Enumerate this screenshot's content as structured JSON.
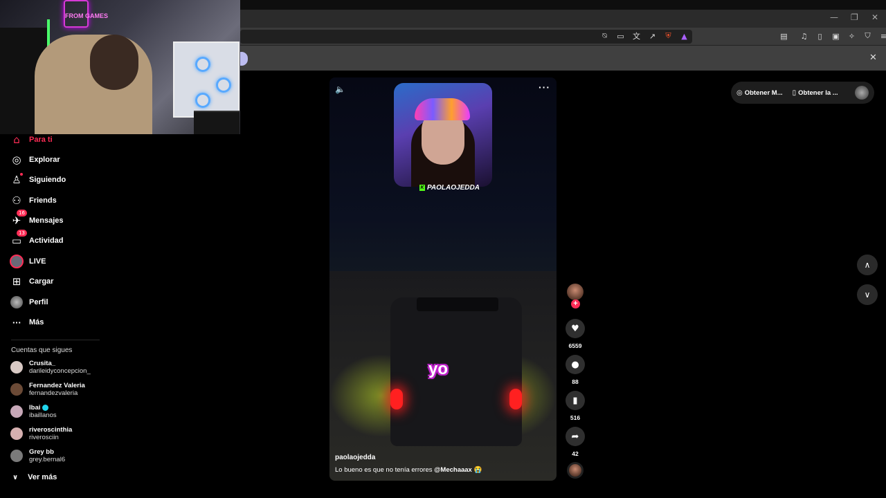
{
  "browser": {
    "window_controls": [
      "—",
      "❐",
      "✕"
    ],
    "toolbar_icons": [
      "no-wifi-icon",
      "cast-icon",
      "translate-icon",
      "share-icon",
      "brave-shield-icon",
      "brave-rewards-icon"
    ],
    "right_icons": [
      "reader-icon",
      "music-icon",
      "sidebar-icon",
      "wallet-icon",
      "leo-icon",
      "vpn-icon",
      "menu-icon"
    ],
    "bookmark_close": "✕"
  },
  "webcam": {
    "neon_sign": "FROM GAMES"
  },
  "sidebar": {
    "items": [
      {
        "label": "Para ti",
        "icon": "home-icon",
        "glyph": "⌂",
        "active": true
      },
      {
        "label": "Explorar",
        "icon": "compass-icon",
        "glyph": "◎"
      },
      {
        "label": "Siguiendo",
        "icon": "following-icon",
        "glyph": "♙"
      },
      {
        "label": "Friends",
        "icon": "friends-icon",
        "glyph": "⚇"
      },
      {
        "label": "Mensajes",
        "icon": "messages-icon",
        "glyph": "✈",
        "badge": "16"
      },
      {
        "label": "Actividad",
        "icon": "activity-icon",
        "glyph": "▭",
        "badge": "13"
      },
      {
        "label": "LIVE",
        "icon": "live-icon"
      },
      {
        "label": "Cargar",
        "icon": "upload-icon",
        "glyph": "⊞"
      },
      {
        "label": "Perfil",
        "icon": "profile-icon"
      },
      {
        "label": "Más",
        "icon": "more-icon",
        "glyph": "···"
      }
    ],
    "following_title": "Cuentas que sigues",
    "accounts": [
      {
        "name": "Crusita_",
        "handle": "darileidyconcepcion_",
        "color": "#d8c9c4",
        "verified": false
      },
      {
        "name": "Fernandez Valeria",
        "handle": "fernandezvaleria",
        "color": "#6b4a36",
        "verified": false
      },
      {
        "name": "Ibai",
        "handle": "ibaillanos",
        "color": "#c7a8b8",
        "verified": true
      },
      {
        "name": "riveroscinthia",
        "handle": "riverosciin",
        "color": "#d6b0b0",
        "verified": false
      },
      {
        "name": "Grey bb",
        "handle": "grey.bernal6",
        "color": "#7a7a7a",
        "verified": false
      }
    ],
    "see_more": "Ver más",
    "see_more_icon": "chevron-down-icon"
  },
  "video": {
    "streamer_tag": "PAOLAOJEDDA",
    "overlay_text": "yo",
    "author": "paolaojedda",
    "caption": "Lo bueno es que no tenía errores",
    "mention": "@Mechaaax",
    "emoji": "😭",
    "volume_icon": "volume-icon",
    "more_icon": "more-options-icon"
  },
  "actions": {
    "likes": "6559",
    "comments": "88",
    "saves": "516",
    "shares": "42",
    "follow": "+"
  },
  "topright": {
    "chip1": "Obtener M...",
    "chip2": "Obtener la ..."
  },
  "nav": {
    "up": "︿",
    "down": "﹀"
  }
}
